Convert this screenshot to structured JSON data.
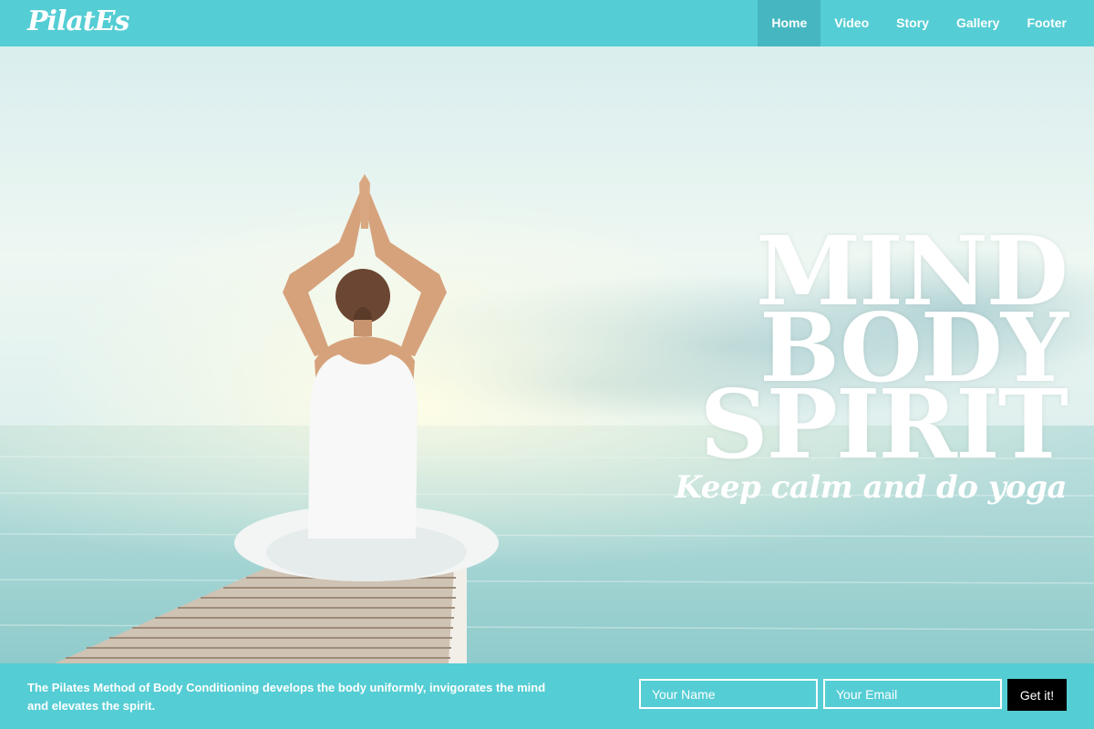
{
  "brand": {
    "logo": "PilatEs"
  },
  "nav": {
    "items": [
      {
        "label": "Home",
        "active": true
      },
      {
        "label": "Video"
      },
      {
        "label": "Story"
      },
      {
        "label": "Gallery"
      },
      {
        "label": "Footer"
      }
    ]
  },
  "hero": {
    "headline": [
      "MIND",
      "BODY",
      "SPIRIT"
    ],
    "tagline": "Keep calm and do yoga",
    "image": "woman-meditating-on-pier-by-sea"
  },
  "footer": {
    "text": "The Pilates Method of Body Conditioning develops the body uniformly, invigorates the mind and elevates the spirit.",
    "name_placeholder": "Your Name",
    "email_placeholder": "Your Email",
    "submit_label": "Get it!"
  },
  "colors": {
    "accent": "#55cdd4",
    "accent_dark": "#46b7c0",
    "button": "#000000"
  }
}
